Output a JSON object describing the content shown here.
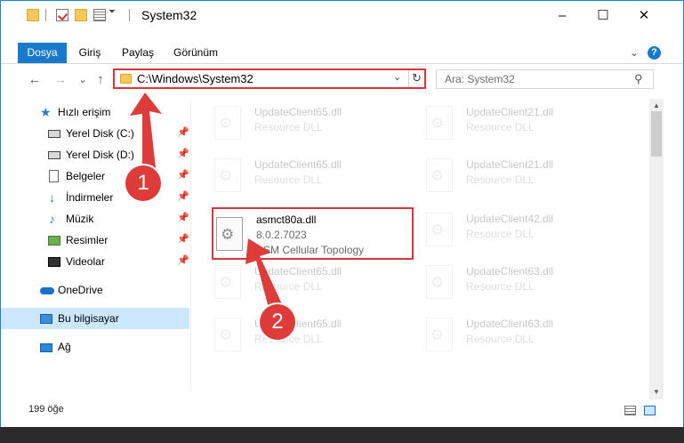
{
  "window": {
    "title": "System32",
    "controls": {
      "minimize": "–",
      "maximize": "☐",
      "close": "✕"
    }
  },
  "ribbon": {
    "tabs": [
      {
        "label": "Dosya",
        "active": true
      },
      {
        "label": "Giriş",
        "active": false
      },
      {
        "label": "Paylaş",
        "active": false
      },
      {
        "label": "Görünüm",
        "active": false
      }
    ],
    "expand_icon": "chevron-down-icon",
    "help_label": "?"
  },
  "navbar": {
    "back": "←",
    "forward": "→",
    "recent": "⌄",
    "up": "↑",
    "address": "C:\\Windows\\System32",
    "dropdown": "⌄",
    "refresh": "↻",
    "search_placeholder": "Ara: System32",
    "search_icon": "⚲"
  },
  "sidebar": {
    "items": [
      {
        "label": "Hızlı erişim",
        "icon": "star-icon",
        "pinned": false
      },
      {
        "label": "Yerel Disk (C:)",
        "icon": "drive-icon",
        "pinned": true
      },
      {
        "label": "Yerel Disk (D:)",
        "icon": "drive-icon",
        "pinned": true
      },
      {
        "label": "Belgeler",
        "icon": "documents-icon",
        "pinned": true
      },
      {
        "label": "İndirmeler",
        "icon": "download-icon",
        "pinned": true
      },
      {
        "label": "Müzik",
        "icon": "music-icon",
        "pinned": true
      },
      {
        "label": "Resimler",
        "icon": "pictures-icon",
        "pinned": true
      },
      {
        "label": "Videolar",
        "icon": "videos-icon",
        "pinned": true
      },
      {
        "label": "OneDrive",
        "icon": "cloud-icon",
        "pinned": false
      },
      {
        "label": "Bu bilgisayar",
        "icon": "computer-icon",
        "pinned": false,
        "selected": true
      },
      {
        "label": "Ağ",
        "icon": "network-icon",
        "pinned": false
      }
    ],
    "pin_glyph": "📌"
  },
  "files": {
    "left": [
      {
        "name": "UpdateClient65.dll",
        "sub": "Resource DLL"
      },
      {
        "name": "UpdateClient65.dll",
        "sub": "Resource DLL"
      },
      {
        "name": "asmct80a.dll",
        "version": "8.0.2.7023",
        "desc": "ASM Cellular Topology",
        "highlighted": true
      },
      {
        "name": "UpdateClient65.dll",
        "sub": "Resource DLL"
      },
      {
        "name": "UpdateClient65.dll",
        "sub": "Resource DLL"
      }
    ],
    "right": [
      {
        "name": "UpdateClient21.dll",
        "sub": "Resource DLL"
      },
      {
        "name": "UpdateClient21.dll",
        "sub": "Resource DLL"
      },
      {
        "name": "UpdateClient42.dll",
        "sub": "Resource DLL"
      },
      {
        "name": "UpdateClient63.dll",
        "sub": "Resource DLL"
      },
      {
        "name": "UpdateClient63.dll",
        "sub": "Resource DLL"
      }
    ]
  },
  "status": {
    "count": "199 öğe"
  },
  "annotations": {
    "step1": "1",
    "step2": "2",
    "color": "#de3b3b"
  },
  "colors": {
    "accent": "#1979ca",
    "highlight_border": "#d8353b",
    "selected_bg": "#cce8ff"
  }
}
